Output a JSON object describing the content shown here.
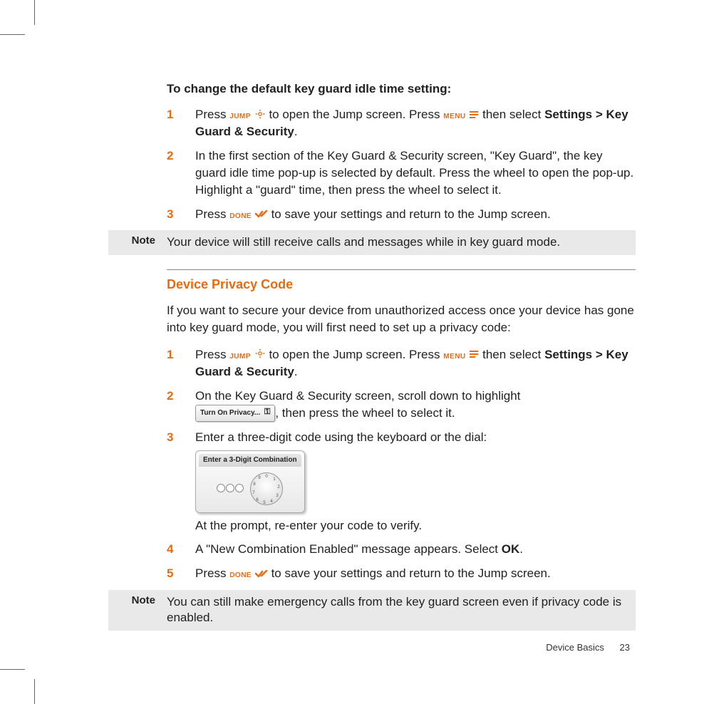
{
  "section1": {
    "heading": "To change the default key guard idle time setting:",
    "steps": [
      {
        "n": "1",
        "pre": "Press ",
        "k1": "JUMP",
        "mid": " to open the Jump screen. Press ",
        "k2": "MENU",
        "post": " then select ",
        "bold": "Settings > Key Guard & Security",
        "end": "."
      },
      {
        "n": "2",
        "text": "In the first section of the Key Guard & Security screen, \"Key Guard\", the key guard idle time pop-up is selected by default. Press the wheel to open the pop-up. Highlight a \"guard\" time, then press the wheel to select it."
      },
      {
        "n": "3",
        "pre": "Press ",
        "k1": "DONE",
        "post": " to save your settings and return to the Jump screen."
      }
    ],
    "note_label": "Note",
    "note_body": "Your device will still receive calls and messages while in key guard mode."
  },
  "section2": {
    "title": "Device Privacy Code",
    "intro": "If you want to secure your device from unauthorized access once your device has gone into key guard mode, you will first need to set up a privacy code:",
    "steps": {
      "s1": {
        "n": "1",
        "pre": "Press ",
        "k1": "JUMP",
        "mid": " to open the Jump screen. Press ",
        "k2": "MENU",
        "post": " then select ",
        "bold": "Settings > Key Guard & Security",
        "end": "."
      },
      "s2": {
        "n": "2",
        "pre": "On the Key Guard & Security screen, scroll down to highlight ",
        "btn": "Turn On Privacy...",
        "post": ", then press the wheel to select it."
      },
      "s3": {
        "n": "3",
        "pre": "Enter a three-digit code using the keyboard or the dial:",
        "dial_title": "Enter a 3-Digit Combination",
        "after": "At the prompt, re-enter your code to verify."
      },
      "s4": {
        "n": "4",
        "pre": "A \"New Combination Enabled\" message appears. Select ",
        "bold": "OK",
        "end": "."
      },
      "s5": {
        "n": "5",
        "pre": "Press ",
        "k1": "DONE",
        "post": " to save your settings and return to the Jump screen."
      }
    },
    "note_label": "Note",
    "note_body": "You can still make emergency calls from the key guard screen even if privacy code is enabled."
  },
  "footer": {
    "section": "Device Basics",
    "page": "23"
  }
}
